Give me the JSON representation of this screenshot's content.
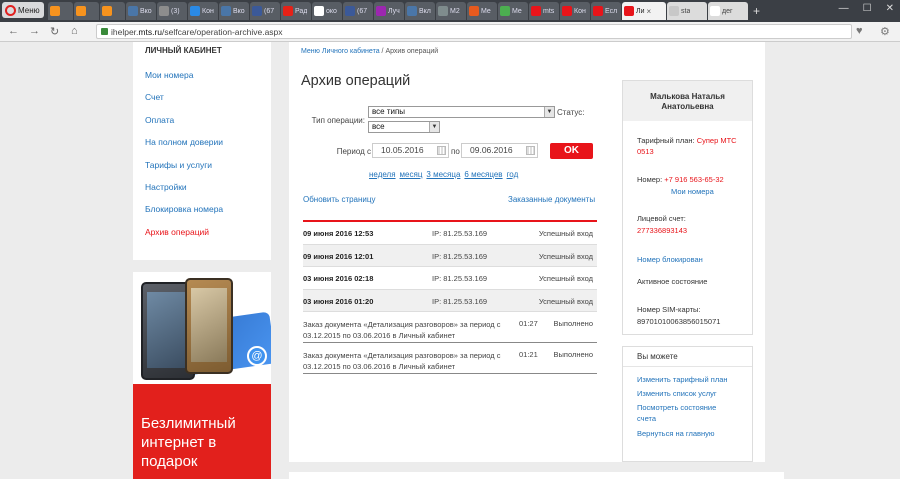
{
  "browser": {
    "menu_label": "Меню",
    "tabs": [
      {
        "title": "",
        "icon": "odnoklassniki-icon",
        "color": "#f7931e"
      },
      {
        "title": "",
        "icon": "odnoklassniki-icon",
        "color": "#f7931e"
      },
      {
        "title": "",
        "icon": "odnoklassniki-icon",
        "color": "#f7931e"
      },
      {
        "title": "Вко",
        "icon": "vk-icon",
        "color": "#4a76a8"
      },
      {
        "title": "(3)",
        "icon": "page-icon",
        "color": "#8d8d8d"
      },
      {
        "title": "Кон",
        "icon": "plus-icon",
        "color": "#2a8ae6"
      },
      {
        "title": "Вко",
        "icon": "vk-icon",
        "color": "#4a76a8"
      },
      {
        "title": "(67",
        "icon": "facebook-icon",
        "color": "#3b5998"
      },
      {
        "title": "Рад",
        "icon": "youtube-icon",
        "color": "#e62117"
      },
      {
        "title": "око",
        "icon": "google-icon",
        "color": "#ffffff"
      },
      {
        "title": "(67",
        "icon": "facebook-icon",
        "color": "#3b5998"
      },
      {
        "title": "Луч",
        "icon": "play-icon",
        "color": "#9c27b0"
      },
      {
        "title": "Вкл",
        "icon": "vk-icon",
        "color": "#4a76a8"
      },
      {
        "title": "M2",
        "icon": "mail-icon",
        "color": "#7f8c8d"
      },
      {
        "title": "Ме",
        "icon": "page-icon",
        "color": "#e65a1e"
      },
      {
        "title": "Ме",
        "icon": "page-icon",
        "color": "#4caf50"
      },
      {
        "title": "mts",
        "icon": "yandex-icon",
        "color": "#e8141a"
      },
      {
        "title": "Кон",
        "icon": "mts-icon",
        "color": "#e8141a"
      },
      {
        "title": "Есл",
        "icon": "mts-icon",
        "color": "#e8141a"
      }
    ],
    "active_tab": {
      "title": "Ли",
      "close": "×"
    },
    "light_tabs": [
      {
        "title": "sta",
        "icon": "page-icon",
        "color": "#c8c8c8"
      },
      {
        "title": "дег",
        "icon": "google-icon",
        "color": "#ffffff"
      }
    ],
    "new_tab": "+",
    "window": {
      "minimize": "—",
      "maximize": "☐",
      "close": "✕"
    },
    "back": "←",
    "forward": "→",
    "reload": "↻",
    "home": "⌂",
    "url_host": "ihelper.",
    "url_domain": "mts.ru",
    "url_path": "/selfcare/operation-archive.aspx",
    "heart": "♥",
    "menu": "⚙"
  },
  "sidebar": {
    "header": "ЛИЧНЫЙ КАБИНЕТ",
    "items": [
      {
        "label": "Мои номера"
      },
      {
        "label": "Счет"
      },
      {
        "label": "Оплата"
      },
      {
        "label": "На полном доверии"
      },
      {
        "label": "Тарифы и услуги"
      },
      {
        "label": "Настройки"
      },
      {
        "label": "Блокировка номера"
      },
      {
        "label": "Архив операций"
      }
    ]
  },
  "promo": {
    "text": "Безлимитный интернет в подарок",
    "at": "@"
  },
  "main": {
    "breadcrumb_link": "Меню Личного кабинета",
    "breadcrumb_sep": "/",
    "breadcrumb_current": "Архив операций",
    "title": "Архив операций",
    "filter": {
      "type_label": "Тип операции:",
      "type_value": "все типы",
      "status_label": "Статус:",
      "status_value": "все",
      "period_label": "Период с",
      "date_from": "10.05.2016",
      "to_label": "по",
      "date_to": "09.06.2016",
      "ok": "OK",
      "quick": [
        "неделя",
        "месяц",
        "3 месяца",
        "6 месяцев",
        "год"
      ]
    },
    "refresh": "Обновить страницу",
    "ordered_docs": "Заказанные документы",
    "operations": [
      {
        "datetime": "09 июня 2016 12:53",
        "ip": "IP: 81.25.53.169",
        "status": "Успешный вход"
      },
      {
        "datetime": "09 июня 2016 12:01",
        "ip": "IP: 81.25.53.169",
        "status": "Успешный вход"
      },
      {
        "datetime": "03 июня 2016 02:18",
        "ip": "IP: 81.25.53.169",
        "status": "Успешный вход"
      },
      {
        "datetime": "03 июня 2016 01:20",
        "ip": "IP: 81.25.53.169",
        "status": "Успешный вход"
      }
    ],
    "orders": [
      {
        "desc": "Заказ документа «Детализация разговоров» за период с 03.12.2015 по 03.06.2016 в Личный кабинет",
        "time": "01:27",
        "status": "Выполнено"
      },
      {
        "desc": "Заказ документа «Детализация разговоров» за период с 03.12.2015 по 03.06.2016 в Личный кабинет",
        "time": "01:21",
        "status": "Выполнено"
      }
    ]
  },
  "account": {
    "name": "Малькова Наталья Анатольевна",
    "tariff_label": "Тарифный план:",
    "tariff": "Супер МТС 0513",
    "phone_label": "Номер:",
    "phone": "+7 916 563-65-32",
    "my_numbers": "Мои номера",
    "account_label": "Лицевой счет:",
    "account_number": "277336893143",
    "blocked": "Номер блокирован",
    "state": "Активное состояние",
    "sim_label": "Номер SIM-карты:",
    "sim": "89701010063856015071"
  },
  "actions": {
    "header": "Вы можете",
    "items": [
      {
        "label": "Изменить тарифный план"
      },
      {
        "label": "Изменить список услуг"
      },
      {
        "label": "Посмотреть состояние счета"
      },
      {
        "label": "Вернуться на главную"
      }
    ]
  }
}
